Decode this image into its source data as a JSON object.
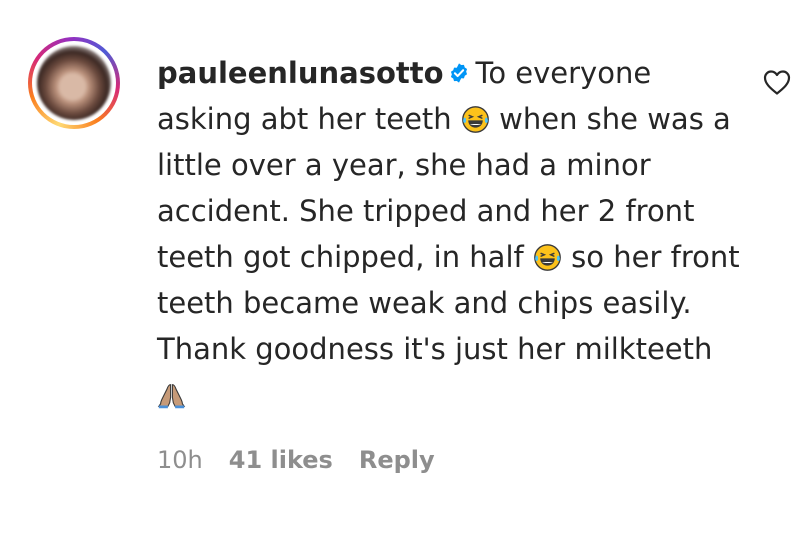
{
  "comment": {
    "username": "pauleenlunasotto",
    "verified_icon": "verified-badge-icon",
    "text_parts": [
      "To everyone asking abt her teeth ",
      " when she was a little over a year, she had a minor accident. She tripped and her 2 front teeth got chipped, in half ",
      " so her front teeth became weak and chips easily. Thank goodness it's just her milkteeth "
    ],
    "emojis": [
      "laughing-tears-emoji",
      "laughing-tears-emoji",
      "praying-hands-emoji"
    ]
  },
  "meta": {
    "time": "10h",
    "likes": "41 likes",
    "reply": "Reply"
  },
  "colors": {
    "text": "#262626",
    "muted": "#8e8e8e",
    "verified": "#0095f6"
  }
}
